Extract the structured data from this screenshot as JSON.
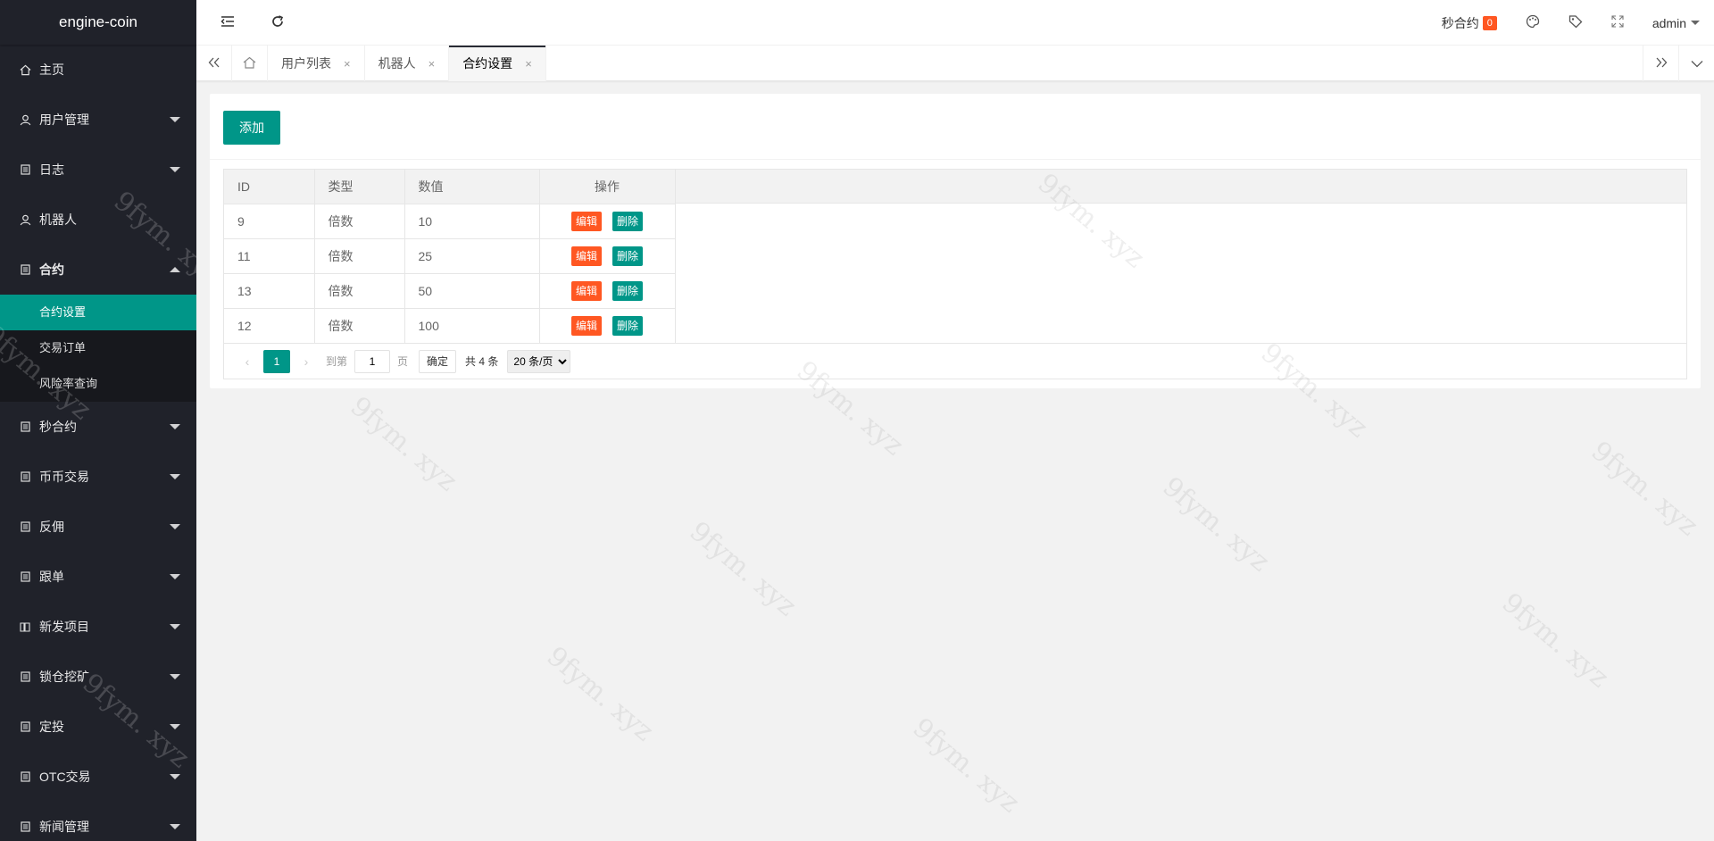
{
  "app": {
    "name": "engine-coin"
  },
  "sidebar": {
    "items": [
      {
        "label": "主页",
        "icon": "home-icon",
        "caret": "none"
      },
      {
        "label": "用户管理",
        "icon": "user-icon",
        "caret": "down"
      },
      {
        "label": "日志",
        "icon": "doc-icon",
        "caret": "down"
      },
      {
        "label": "机器人",
        "icon": "user-icon",
        "caret": "none"
      },
      {
        "label": "合约",
        "icon": "doc-icon",
        "caret": "up"
      },
      {
        "label": "秒合约",
        "icon": "doc-icon",
        "caret": "down"
      },
      {
        "label": "币币交易",
        "icon": "doc-icon",
        "caret": "down"
      },
      {
        "label": "反佣",
        "icon": "doc-icon",
        "caret": "down"
      },
      {
        "label": "跟单",
        "icon": "doc-icon",
        "caret": "down"
      },
      {
        "label": "新发项目",
        "icon": "book-icon",
        "caret": "down"
      },
      {
        "label": "锁仓挖矿",
        "icon": "doc-icon",
        "caret": "down"
      },
      {
        "label": "定投",
        "icon": "doc-icon",
        "caret": "down"
      },
      {
        "label": "OTC交易",
        "icon": "doc-icon",
        "caret": "down"
      },
      {
        "label": "新闻管理",
        "icon": "doc-icon",
        "caret": "down"
      }
    ],
    "contract_submenu": [
      "合约设置",
      "交易订单",
      "风险率查询"
    ]
  },
  "header": {
    "second_contract_label": "秒合约",
    "second_contract_count": "0",
    "user": "admin"
  },
  "tabs": {
    "items": [
      {
        "label": "用户列表",
        "close": "×"
      },
      {
        "label": "机器人",
        "close": "×"
      },
      {
        "label": "合约设置",
        "close": "×"
      }
    ]
  },
  "toolbar": {
    "add_label": "添加"
  },
  "table": {
    "headers": [
      "ID",
      "类型",
      "数值",
      "操作"
    ],
    "rows": [
      {
        "id": "9",
        "type": "倍数",
        "value": "10"
      },
      {
        "id": "11",
        "type": "倍数",
        "value": "25"
      },
      {
        "id": "13",
        "type": "倍数",
        "value": "50"
      },
      {
        "id": "12",
        "type": "倍数",
        "value": "100"
      }
    ],
    "edit_label": "编辑",
    "delete_label": "删除"
  },
  "pager": {
    "current": "1",
    "goto_label": "到第",
    "goto_value": "1",
    "page_unit": "页",
    "confirm_label": "确定",
    "total_text": "共 4 条",
    "page_size": "20 条/页"
  },
  "watermark": "9fym. xyz",
  "colors": {
    "sidebar_bg": "#20222a",
    "accent": "#009688",
    "danger": "#ff5722"
  }
}
